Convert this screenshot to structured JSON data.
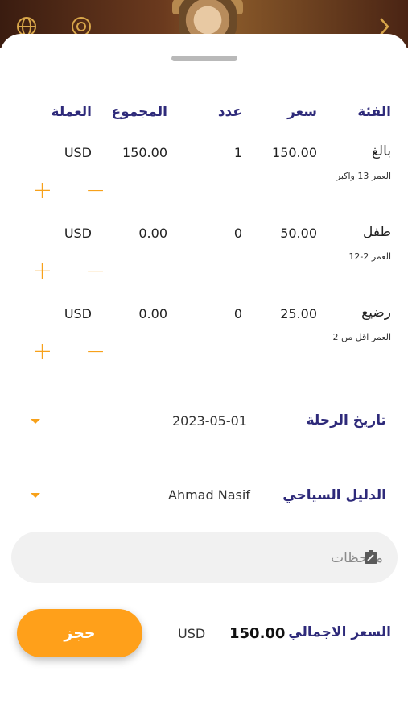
{
  "header": {
    "left_icons": [
      "globe-icon",
      "compass-icon"
    ],
    "right_icon": "chevron-right-icon"
  },
  "table": {
    "columns": {
      "category": "الفئة",
      "price": "سعر",
      "count": "عدد",
      "total": "المجموع",
      "currency": "العملة"
    },
    "rows": [
      {
        "category": "بالغ",
        "note": "العمر 13 واكبر",
        "price": "150.00",
        "count": "1",
        "total": "150.00",
        "currency": "USD"
      },
      {
        "category": "طفل",
        "note": "العمر 2-12",
        "price": "50.00",
        "count": "0",
        "total": "0.00",
        "currency": "USD"
      },
      {
        "category": "رضيع",
        "note": "العمر اقل من 2",
        "price": "25.00",
        "count": "0",
        "total": "0.00",
        "currency": "USD"
      }
    ],
    "plus_symbol": "+",
    "minus_symbol": "−"
  },
  "trip_date": {
    "label": "تاريخ الرحلة",
    "value": "2023-05-01"
  },
  "guide": {
    "label": "الدليل السياحي",
    "value": "Ahmad Nasif"
  },
  "notes": {
    "placeholder": "ملاحظات",
    "icon": "edit-note-icon"
  },
  "summary": {
    "label": "السعر الاجمالي",
    "total": "150.00",
    "currency": "USD"
  },
  "book_button": {
    "label": "حجز"
  },
  "colors": {
    "accent": "#ffa01a",
    "heading": "#2e2a7a"
  }
}
